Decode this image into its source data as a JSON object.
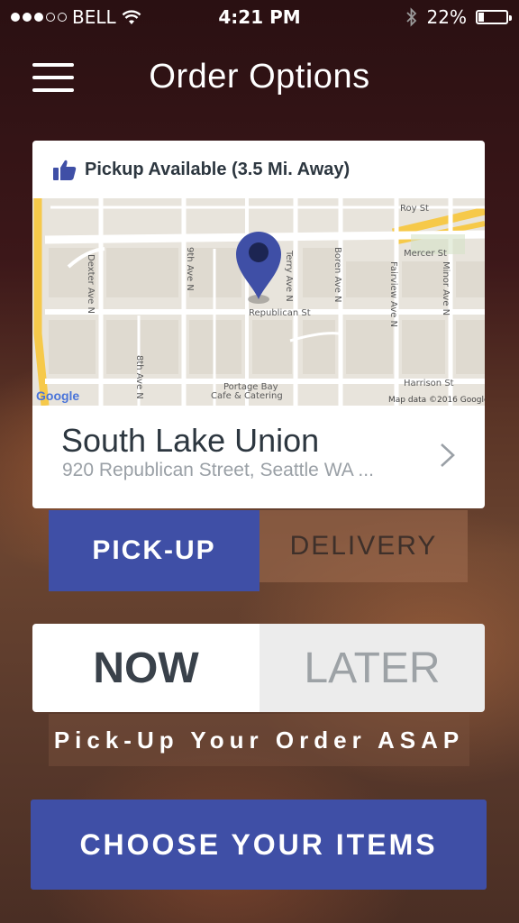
{
  "status_bar": {
    "carrier": "BELL",
    "time": "4:21 PM",
    "battery": "22%",
    "battery_level": 0.22,
    "signal_dots_filled": 3,
    "signal_dots_total": 5
  },
  "header": {
    "title": "Order Options",
    "menu_icon": "hamburger-menu-icon"
  },
  "pickup_card": {
    "availability": "Pickup Available (3.5 Mi. Away)",
    "availability_icon": "thumbs-up-icon",
    "map": {
      "streets": {
        "roy": "Roy St",
        "mercer": "Mercer St",
        "republican": "Republican St",
        "harrison": "Harrison St",
        "dexter": "Dexter Ave N",
        "ninth": "9th Ave N",
        "eighth": "8th Ave N",
        "terry": "Terry Ave N",
        "boren": "Boren Ave N",
        "fairview": "Fairview Ave N",
        "minor": "Minor Ave N"
      },
      "poi": "Portage Bay",
      "poi_sub": "Cafe & Catering",
      "attribution": "Map data ©2016 Google",
      "logo": "Google",
      "marker_icon": "map-pin-icon"
    },
    "location_name": "South Lake Union",
    "address": "920 Republican Street, Seattle WA ...",
    "chevron_icon": "chevron-right-icon"
  },
  "method_toggle": {
    "selected": "PICK-UP",
    "other": "DELIVERY"
  },
  "time_toggle": {
    "selected": "NOW",
    "other": "LATER"
  },
  "time_caption": "Pick-Up Your Order ASAP",
  "cta_label": "CHOOSE YOUR ITEMS",
  "colors": {
    "accent": "#3f4fa6",
    "background": "#3b1d1c",
    "pin": "#3f4fa6",
    "highway": "#f6c94a"
  }
}
